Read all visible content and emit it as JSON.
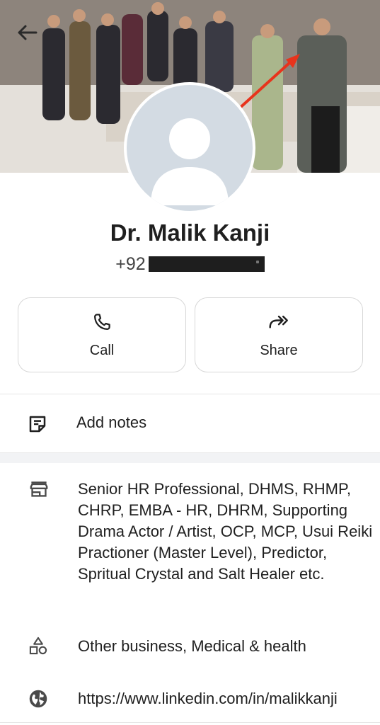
{
  "contact": {
    "name": "Dr. Malik Kanji",
    "phone_prefix": "+92"
  },
  "actions": {
    "call_label": "Call",
    "share_label": "Share"
  },
  "notes": {
    "label": "Add notes"
  },
  "details": {
    "description": "Senior HR Professional, DHMS, RHMP, CHRP, EMBA - HR, DHRM, Supporting Drama Actor / Artist, OCP, MCP, Usui Reiki Practioner (Master Level), Predictor, Spritual Crystal and Salt Healer etc.",
    "category": "Other business, Medical & health",
    "website": "https://www.linkedin.com/in/malikkanji"
  },
  "colors": {
    "link": "#1a5fb4",
    "annotation_arrow": "#e8331c",
    "avatar_bg": "#d3dbe3"
  }
}
